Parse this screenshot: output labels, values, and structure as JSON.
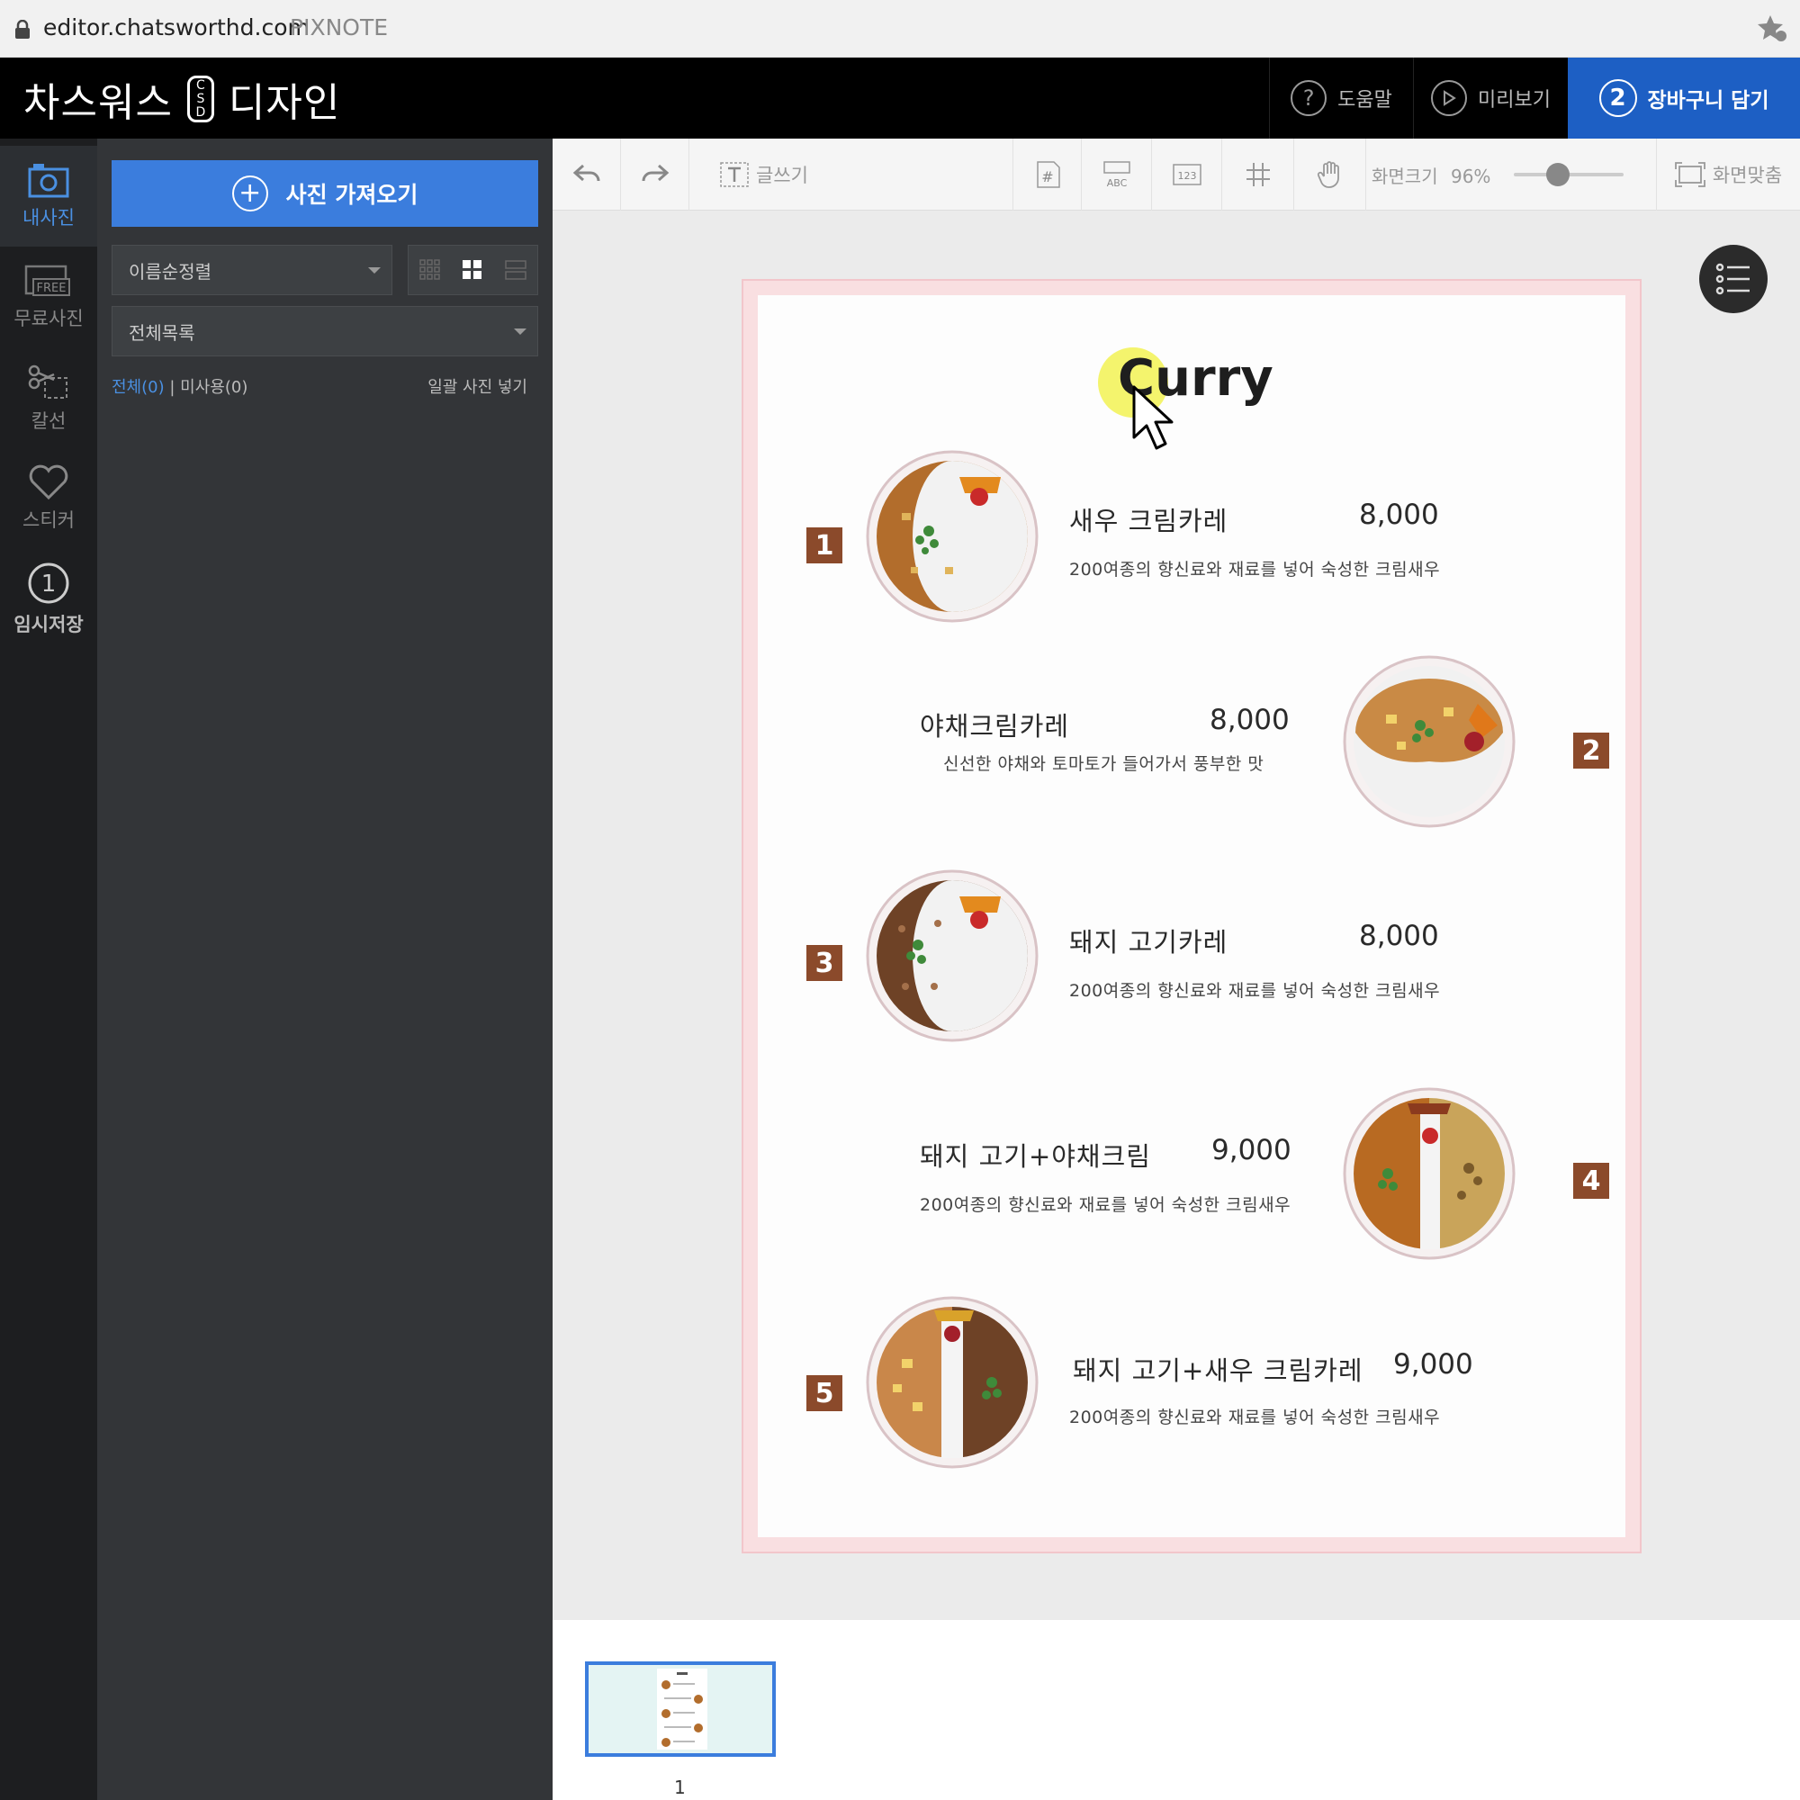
{
  "browser": {
    "url": "editor.chatsworthd.com",
    "site_name": "PIXNOTE"
  },
  "header": {
    "brand_left": "차스워스",
    "brand_badge": [
      "C",
      "S",
      "D"
    ],
    "brand_right": "디자인",
    "help_label": "도움말",
    "preview_label": "미리보기",
    "cart_step": "2",
    "cart_label": "장바구니 담기"
  },
  "rail": [
    {
      "label": "내사진",
      "icon": "photo-icon",
      "active": true
    },
    {
      "label": "무료사진",
      "icon": "free-photo-icon",
      "badge": "FREE"
    },
    {
      "label": "칼선",
      "icon": "scissors-icon"
    },
    {
      "label": "스티커",
      "icon": "heart-icon"
    },
    {
      "label": "임시저장",
      "icon": "temp-save-icon",
      "step": "1"
    }
  ],
  "panel": {
    "import_label": "사진 가져오기",
    "sort_value": "이름순정렬",
    "list_value": "전체목록",
    "filter_all": "전체(0)",
    "filter_sep": "|",
    "filter_unused": "미사용(0)",
    "bulk_insert": "일괄 사진 넣기"
  },
  "toolbar": {
    "text_tool_label": "글쓰기",
    "zoom_label": "화면크기",
    "zoom_value": "96%",
    "zoom_level_percent": 96,
    "fit_label": "화면맞춤",
    "icons": [
      "undo-icon",
      "redo-icon",
      "text-icon",
      "hashtag-icon",
      "abc-icon",
      "number-icon",
      "grid-icon",
      "hand-icon",
      "fit-icon"
    ]
  },
  "menu": {
    "title": "Curry",
    "items": [
      {
        "num": "1",
        "name": "새우 크림카레",
        "price": "8,000",
        "desc": "200여종의 향신료와 재료를 넣어 숙성한 크림새우"
      },
      {
        "num": "2",
        "name": "야채크림카레",
        "price": "8,000",
        "desc": "신선한 야채와 토마토가 들어가서 풍부한 맛"
      },
      {
        "num": "3",
        "name": "돼지 고기카레",
        "price": "8,000",
        "desc": "200여종의 향신료와 재료를 넣어 숙성한 크림새우"
      },
      {
        "num": "4",
        "name": "돼지 고기+야채크림",
        "price": "9,000",
        "desc": "200여종의 향신료와 재료를 넣어 숙성한 크림새우"
      },
      {
        "num": "5",
        "name": "돼지 고기+새우 크림카레",
        "price": "9,000",
        "desc": "200여종의 향신료와 재료를 넣어 숙성한 크림새우"
      }
    ]
  },
  "pages": {
    "thumbnail_label": "1"
  },
  "colors": {
    "accent_blue": "#3b7ddd",
    "cart_blue": "#1d5fc4",
    "number_badge": "#8b4a2b",
    "page_border_pink": "#f9dfe1"
  }
}
